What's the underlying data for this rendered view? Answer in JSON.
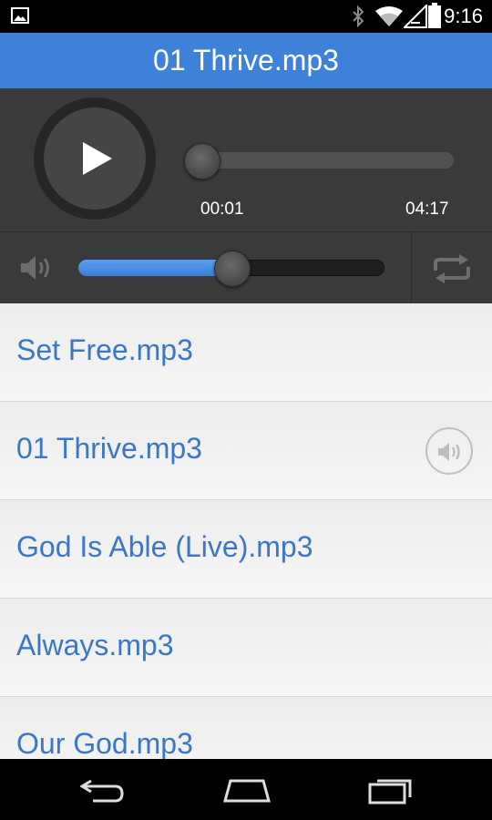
{
  "status_bar": {
    "time": "9:16"
  },
  "header": {
    "title": "01 Thrive.mp3"
  },
  "player": {
    "current_time": "00:01",
    "total_time": "04:17",
    "seek_progress": 0.004,
    "volume_level": 0.5
  },
  "playlist": {
    "tracks": [
      {
        "title": "Set Free.mp3",
        "playing": false
      },
      {
        "title": "01 Thrive.mp3",
        "playing": true
      },
      {
        "title": "God Is Able (Live).mp3",
        "playing": false
      },
      {
        "title": "Always.mp3",
        "playing": false
      },
      {
        "title": "Our God.mp3",
        "playing": false
      }
    ]
  },
  "colors": {
    "accent": "#3d82d8",
    "track_text": "#3b77c2",
    "player_bg": "#3a3a3a"
  },
  "icons": {
    "status": [
      "image-icon",
      "bluetooth-icon",
      "wifi-icon",
      "signal-icon",
      "battery-icon"
    ],
    "player": [
      "play-icon",
      "volume-icon",
      "repeat-icon"
    ],
    "nav": [
      "back-icon",
      "home-icon",
      "recents-icon"
    ]
  }
}
